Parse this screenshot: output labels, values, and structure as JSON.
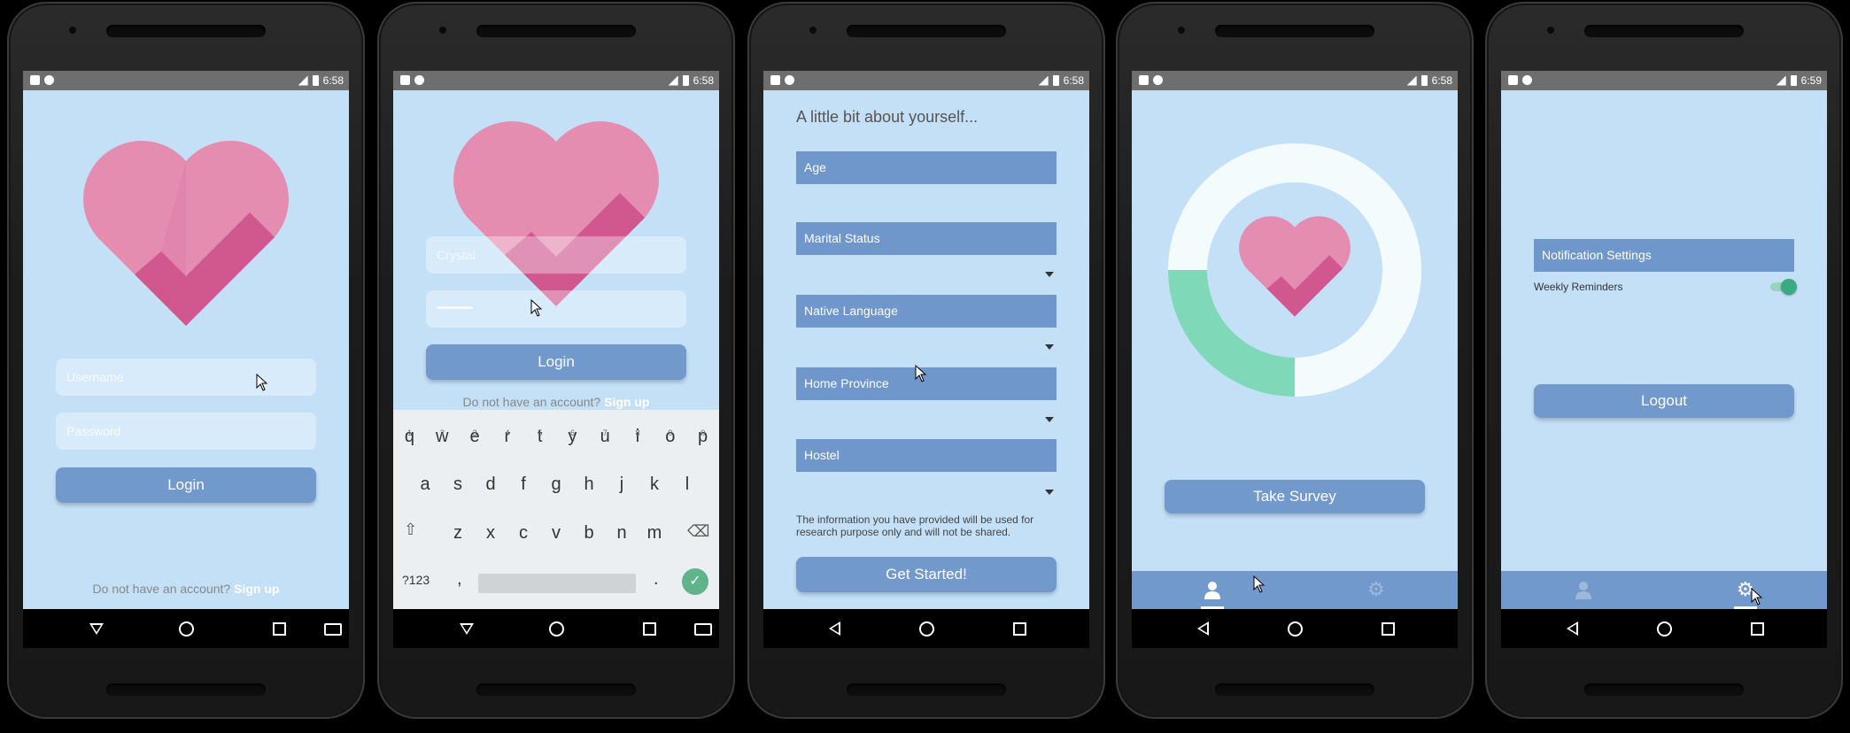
{
  "status": {
    "time1": "6:58",
    "time2": "6:58",
    "time3": "6:58",
    "time4": "6:58",
    "time5": "6:59"
  },
  "phone1": {
    "username_placeholder": "Username",
    "password_placeholder": "Password",
    "login_label": "Login",
    "no_account_text": "Do not have an account?",
    "signup_label": "Sign up"
  },
  "phone2": {
    "username_value": "Crystal",
    "password_value": "••••••••••••••••",
    "login_label": "Login",
    "no_account_text": "Do not have an account?",
    "signup_label": "Sign up",
    "keyboard": {
      "row1": [
        "q",
        "w",
        "e",
        "r",
        "t",
        "y",
        "u",
        "i",
        "o",
        "p"
      ],
      "row1_nums": [
        "1",
        "2",
        "3",
        "4",
        "5",
        "6",
        "7",
        "8",
        "9",
        "0"
      ],
      "row2": [
        "a",
        "s",
        "d",
        "f",
        "g",
        "h",
        "j",
        "k",
        "l"
      ],
      "row3": [
        "z",
        "x",
        "c",
        "v",
        "b",
        "n",
        "m"
      ],
      "sym_label": "?123",
      "comma": ",",
      "period": "."
    }
  },
  "phone3": {
    "heading": "A little bit about yourself...",
    "age_label": "Age",
    "marital_label": "Marital Status",
    "language_label": "Native Language",
    "province_label": "Home Province",
    "hostel_label": "Hostel",
    "disclaimer": "The information you have provided will be used for research purpose only and will not be shared.",
    "get_started_label": "Get Started!"
  },
  "phone4": {
    "take_survey_label": "Take Survey",
    "progress_fraction": 0.25,
    "tabs": [
      "profile-tab",
      "settings-tab"
    ]
  },
  "phone5": {
    "notification_header": "Notification Settings",
    "weekly_label": "Weekly Reminders",
    "weekly_enabled": true,
    "logout_label": "Logout"
  },
  "colors": {
    "bg": "#c3e0f7",
    "accent": "#7199cc",
    "heart_pink": "#e58cb1",
    "heart_dark": "#cc4f8a",
    "progress_green": "#7fd8b8",
    "toggle_green": "#3ba982"
  }
}
